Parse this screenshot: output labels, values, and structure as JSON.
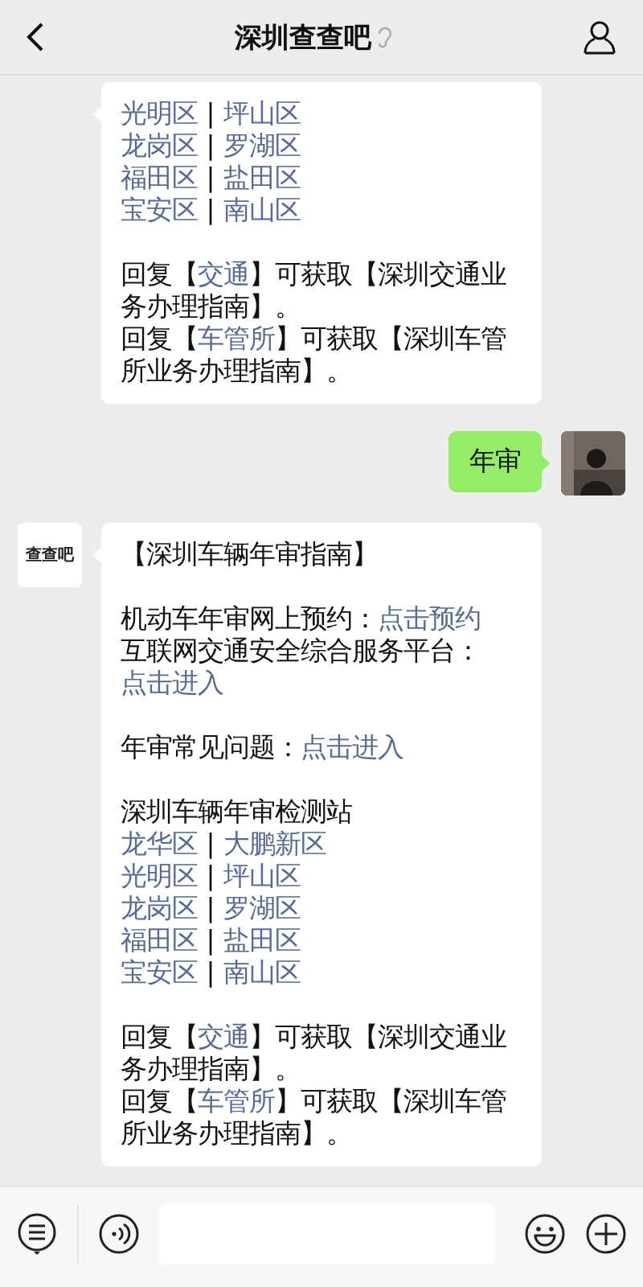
{
  "header": {
    "title": "深圳查查吧"
  },
  "messages": [
    {
      "kind": "received",
      "blocks": [
        [
          [
            {
              "text": "光明区",
              "link": true
            },
            {
              "text": " | ",
              "link": false
            },
            {
              "text": "坪山区",
              "link": true
            }
          ],
          [
            {
              "text": "龙岗区",
              "link": true
            },
            {
              "text": " | ",
              "link": false
            },
            {
              "text": "罗湖区",
              "link": true
            }
          ],
          [
            {
              "text": "福田区",
              "link": true
            },
            {
              "text": " | ",
              "link": false
            },
            {
              "text": "盐田区",
              "link": true
            }
          ],
          [
            {
              "text": "宝安区",
              "link": true
            },
            {
              "text": " | ",
              "link": false
            },
            {
              "text": "南山区",
              "link": true
            }
          ]
        ],
        [
          [
            {
              "text": "回复【",
              "link": false
            },
            {
              "text": "交通",
              "link": true
            },
            {
              "text": "】可获取【深圳交通业务办理指南】。",
              "link": false
            }
          ],
          [
            {
              "text": "回复【",
              "link": false
            },
            {
              "text": "车管所",
              "link": true
            },
            {
              "text": "】可获取【深圳车管所业务办理指南】。",
              "link": false
            }
          ]
        ]
      ]
    },
    {
      "kind": "sent",
      "avatar": {
        "kind": "picture"
      },
      "blocks": [
        [
          [
            {
              "text": "年审",
              "link": false
            }
          ]
        ]
      ]
    },
    {
      "kind": "received",
      "avatar": {
        "logo": "查查吧"
      },
      "blocks": [
        [
          [
            {
              "text": "【深圳车辆年审指南】",
              "link": false
            }
          ]
        ],
        [
          [
            {
              "text": "机动车年审网上预约：",
              "link": false
            },
            {
              "text": "点击预约",
              "link": true
            }
          ],
          [
            {
              "text": "互联网交通安全综合服务平台：",
              "link": false
            },
            {
              "text": "点击进入",
              "link": true
            }
          ]
        ],
        [
          [
            {
              "text": "年审常见问题：",
              "link": false
            },
            {
              "text": "点击进入",
              "link": true
            }
          ]
        ],
        [
          [
            {
              "text": "深圳车辆年审检测站",
              "link": false
            }
          ],
          [
            {
              "text": "龙华区",
              "link": true
            },
            {
              "text": " | ",
              "link": false
            },
            {
              "text": "大鹏新区",
              "link": true
            }
          ],
          [
            {
              "text": "光明区",
              "link": true
            },
            {
              "text": " | ",
              "link": false
            },
            {
              "text": "坪山区",
              "link": true
            }
          ],
          [
            {
              "text": "龙岗区",
              "link": true
            },
            {
              "text": " | ",
              "link": false
            },
            {
              "text": "罗湖区",
              "link": true
            }
          ],
          [
            {
              "text": "福田区",
              "link": true
            },
            {
              "text": " | ",
              "link": false
            },
            {
              "text": "盐田区",
              "link": true
            }
          ],
          [
            {
              "text": "宝安区",
              "link": true
            },
            {
              "text": " | ",
              "link": false
            },
            {
              "text": "南山区",
              "link": true
            }
          ]
        ],
        [
          [
            {
              "text": "回复【",
              "link": false
            },
            {
              "text": "交通",
              "link": true
            },
            {
              "text": "】可获取【深圳交通业务办理指南】。",
              "link": false
            }
          ],
          [
            {
              "text": "回复【",
              "link": false
            },
            {
              "text": "车管所",
              "link": true
            },
            {
              "text": "】可获取【深圳车管所业务办理指南】。",
              "link": false
            }
          ]
        ]
      ]
    }
  ]
}
